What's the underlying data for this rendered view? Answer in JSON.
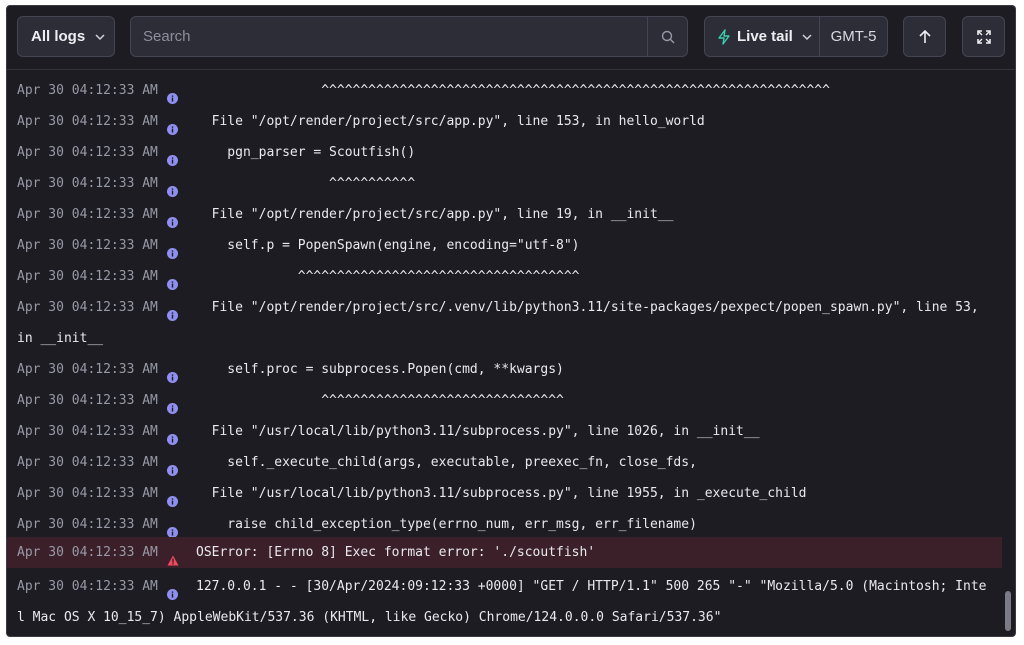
{
  "toolbar": {
    "log_filter": "All logs",
    "search_placeholder": "Search",
    "live_tail_label": "Live tail",
    "timezone": "GMT-5"
  },
  "colors": {
    "background": "#1c1c22",
    "error_row": "#3b2029",
    "info_icon": "#8f8ff0",
    "error_icon": "#ef4a5d",
    "live_tail_icon": "#3ccfb0"
  },
  "logs": [
    {
      "ts": "Apr 30 04:12:33 AM",
      "level": "info",
      "msg": "                ^^^^^^^^^^^^^^^^^^^^^^^^^^^^^^^^^^^^^^^^^^^^^^^^^^^^^^^^^^^^^^^^^"
    },
    {
      "ts": "Apr 30 04:12:33 AM",
      "level": "info",
      "msg": "  File \"/opt/render/project/src/app.py\", line 153, in hello_world"
    },
    {
      "ts": "Apr 30 04:12:33 AM",
      "level": "info",
      "msg": "    pgn_parser = Scoutfish()"
    },
    {
      "ts": "Apr 30 04:12:33 AM",
      "level": "info",
      "msg": "                 ^^^^^^^^^^^"
    },
    {
      "ts": "Apr 30 04:12:33 AM",
      "level": "info",
      "msg": "  File \"/opt/render/project/src/app.py\", line 19, in __init__"
    },
    {
      "ts": "Apr 30 04:12:33 AM",
      "level": "info",
      "msg": "    self.p = PopenSpawn(engine, encoding=\"utf-8\")"
    },
    {
      "ts": "Apr 30 04:12:33 AM",
      "level": "info",
      "msg": "             ^^^^^^^^^^^^^^^^^^^^^^^^^^^^^^^^^^^^"
    },
    {
      "ts": "Apr 30 04:12:33 AM",
      "level": "info",
      "wrap": true,
      "msg": "  File \"/opt/render/project/src/.venv/lib/python3.11/site-packages/pexpect/popen_spawn.py\", line 53, in __init__"
    },
    {
      "ts": "Apr 30 04:12:33 AM",
      "level": "info",
      "msg": "    self.proc = subprocess.Popen(cmd, **kwargs)"
    },
    {
      "ts": "Apr 30 04:12:33 AM",
      "level": "info",
      "msg": "                ^^^^^^^^^^^^^^^^^^^^^^^^^^^^^^^"
    },
    {
      "ts": "Apr 30 04:12:33 AM",
      "level": "info",
      "msg": "  File \"/usr/local/lib/python3.11/subprocess.py\", line 1026, in __init__"
    },
    {
      "ts": "Apr 30 04:12:33 AM",
      "level": "info",
      "msg": "    self._execute_child(args, executable, preexec_fn, close_fds,"
    },
    {
      "ts": "Apr 30 04:12:33 AM",
      "level": "info",
      "msg": "  File \"/usr/local/lib/python3.11/subprocess.py\", line 1955, in _execute_child"
    },
    {
      "ts": "Apr 30 04:12:33 AM",
      "level": "info",
      "msg": "    raise child_exception_type(errno_num, err_msg, err_filename)"
    },
    {
      "ts": "Apr 30 04:12:33 AM",
      "level": "error",
      "msg": "OSError: [Errno 8] Exec format error: './scoutfish'"
    },
    {
      "ts": "Apr 30 04:12:33 AM",
      "level": "info",
      "wrap": true,
      "msg": "127.0.0.1 - - [30/Apr/2024:09:12:33 +0000] \"GET / HTTP/1.1\" 500 265 \"-\" \"Mozilla/5.0 (Macintosh; Intel Mac OS X 10_15_7) AppleWebKit/537.36 (KHTML, like Gecko) Chrome/124.0.0.0 Safari/537.36\""
    }
  ]
}
